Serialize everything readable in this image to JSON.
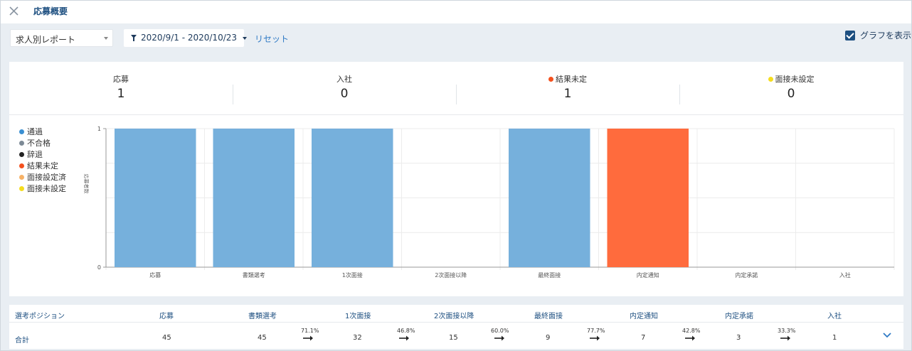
{
  "window": {
    "title": "応募概要",
    "close_icon": "close-icon"
  },
  "toolbar": {
    "report_select": "求人別レポート",
    "date_range": "2020/9/1 - 2020/10/23",
    "reset_label": "リセット",
    "show_graph_label": "グラフを表示",
    "show_graph_checked": true
  },
  "stats": [
    {
      "label": "応募",
      "value": "1",
      "dot": null
    },
    {
      "label": "入社",
      "value": "0",
      "dot": null
    },
    {
      "label": "結果未定",
      "value": "1",
      "dot": "#f4511e"
    },
    {
      "label": "面接未設定",
      "value": "0",
      "dot": "#f5dd1e"
    }
  ],
  "legend": [
    {
      "label": "通過",
      "color": "#3a8fd2"
    },
    {
      "label": "不合格",
      "color": "#7d8a96"
    },
    {
      "label": "辞退",
      "color": "#222222"
    },
    {
      "label": "結果未定",
      "color": "#f4511e"
    },
    {
      "label": "面接設定済",
      "color": "#f7b267"
    },
    {
      "label": "面接未設定",
      "color": "#f5dd1e"
    }
  ],
  "chart_data": {
    "type": "bar",
    "ylabel": "応募者数",
    "ylim": [
      0,
      1
    ],
    "yticks": [
      "0",
      "1"
    ],
    "grid": true,
    "categories": [
      "応募",
      "書類選考",
      "1次面接",
      "2次面接以降",
      "最終面接",
      "内定通知",
      "内定承諾",
      "入社"
    ],
    "values": [
      1,
      1,
      1,
      0,
      1,
      1,
      0,
      0
    ],
    "bar_colors": [
      "#76b0dc",
      "#76b0dc",
      "#76b0dc",
      "#76b0dc",
      "#76b0dc",
      "#ff6b3d",
      "#76b0dc",
      "#76b0dc"
    ]
  },
  "table": {
    "headers": [
      "選考ポジション",
      "応募",
      "書類選考",
      "1次面接",
      "2次面接以降",
      "最終面接",
      "内定通知",
      "内定承諾",
      "入社"
    ],
    "row": {
      "label": "合計",
      "values": [
        "45",
        "45",
        "32",
        "15",
        "9",
        "7",
        "3",
        "1"
      ],
      "rates": [
        "71.1%",
        "46.8%",
        "60.0%",
        "77.7%",
        "42.8%",
        "33.3%"
      ]
    }
  }
}
